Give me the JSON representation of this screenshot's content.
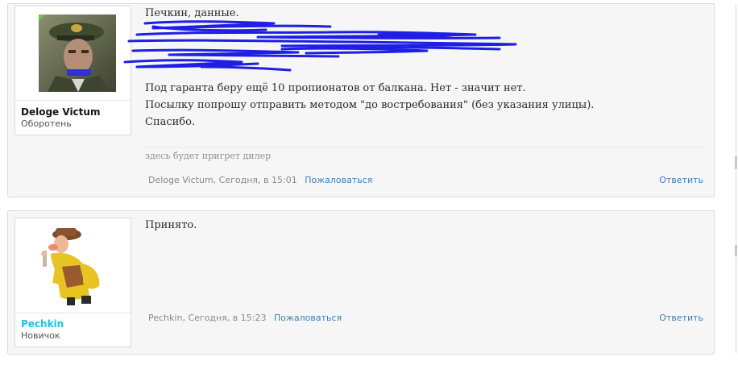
{
  "posts": [
    {
      "username": "Deloge Victum",
      "user_title": "Оборотень",
      "lines": [
        "Печкин, данные.",
        "Под гаранта беру ещё 10 пропионатов от балкана. Нет - значит нет.",
        "Посылку попрошу отправить методом \"до востребования\" (без указания улицы).",
        "Спасибо."
      ],
      "signature": "здесь будет пригрет дилер",
      "author": "Deloge Victum",
      "time": "Сегодня, в 15:01",
      "report_label": "Пожаловаться",
      "reply_label": "Ответить"
    },
    {
      "username": "Pechkin",
      "user_title": "Новичок",
      "lines": [
        "Принято."
      ],
      "author": "Pechkin",
      "time": "Сегодня, в 15:23",
      "report_label": "Пожаловаться",
      "reply_label": "Ответить"
    }
  ],
  "colors": {
    "link": "#3d7fb8",
    "username_pechkin": "#19c6e3",
    "scribble": "#1e1ee6",
    "online_dot": "#7bc043"
  },
  "icons": [
    "avatar-soldier-photo",
    "avatar-cartoon-postman",
    "scribble-redaction"
  ]
}
